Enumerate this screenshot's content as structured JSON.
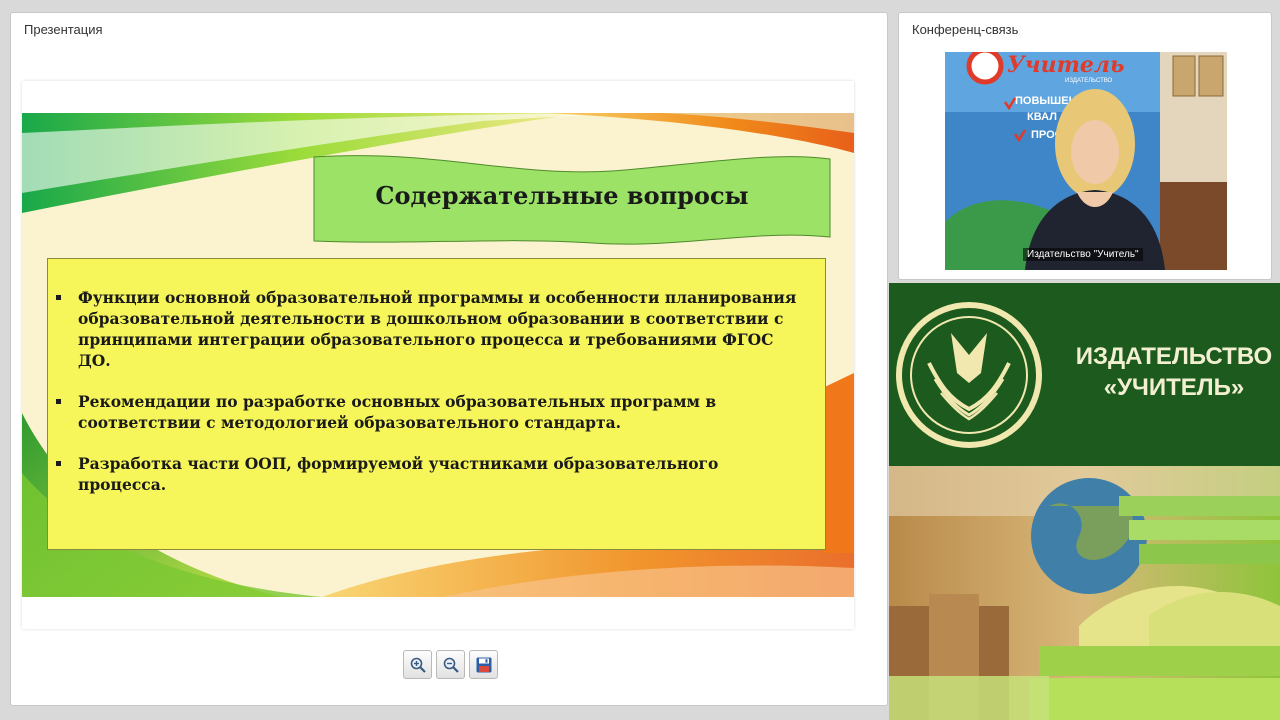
{
  "presentation": {
    "pod_title": "Презентация",
    "slide": {
      "title": "Содержательные вопросы",
      "bullets": [
        "Функции  основной образовательной программы и особенности планирования образовательной деятельности  в  дошкольном образовании в соответствии с принципами интеграции образовательного процесса и требованиями ФГОС ДО.",
        "Рекомендации по  разработке основных образовательных программ в соответствии с методологией образовательного стандарта.",
        "Разработка части ООП, формируемой участниками образовательного процесса."
      ]
    },
    "toolbar": {
      "zoom_in_icon": "zoom-in-icon",
      "zoom_out_icon": "zoom-out-icon",
      "save_icon": "floppy-disk-icon"
    }
  },
  "conference": {
    "pod_title": "Конференц-связь",
    "video_label": "Издательство \"Учитель\"",
    "backdrop_text": {
      "brand": "Учитель",
      "sub": "ИЗДАТЕЛЬСТВО",
      "line1": "ПОВЫШЕН",
      "line2": "КВАЛ",
      "line3": "ПРОФ"
    }
  },
  "branding": {
    "line1": "ИЗДАТЕЛЬСТВО",
    "line2": "«УЧИТЕЛЬ»"
  },
  "colors": {
    "slide_box": "#f6f65a",
    "banner": "#9be267",
    "brand_green": "#1d5a1e",
    "brand_text": "#f3f0d2"
  }
}
